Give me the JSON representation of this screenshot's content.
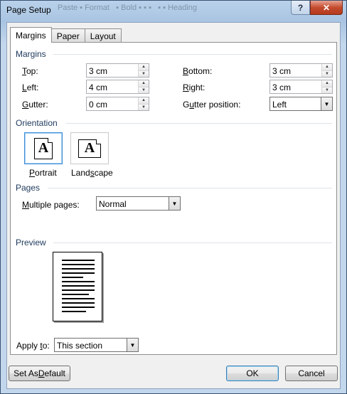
{
  "window": {
    "title": "Page Setup",
    "help_label": "?",
    "close_label": "✕"
  },
  "tabs": [
    {
      "label": "Margins",
      "active": true
    },
    {
      "label": "Paper",
      "active": false
    },
    {
      "label": "Layout",
      "active": false
    }
  ],
  "margins": {
    "section_label": "Margins",
    "top": {
      "label_u": "T",
      "label_rest": "op:",
      "value": "3 cm"
    },
    "left": {
      "label_u": "L",
      "label_rest": "eft:",
      "value": "4 cm"
    },
    "gutter": {
      "label_u": "G",
      "label_rest": "utter:",
      "value": "0 cm"
    },
    "bottom": {
      "label_u": "B",
      "label_rest": "ottom:",
      "value": "3 cm"
    },
    "right": {
      "label_u": "R",
      "label_rest": "ight:",
      "value": "3 cm"
    },
    "gutter_position": {
      "label_pre": "G",
      "label_u": "u",
      "label_rest": "tter position:",
      "value": "Left"
    }
  },
  "orientation": {
    "section_label": "Orientation",
    "icon_glyph": "A",
    "portrait": {
      "label_u": "P",
      "label_rest": "ortrait",
      "selected": true
    },
    "landscape": {
      "label_pre": "Land",
      "label_u": "s",
      "label_rest": "cape",
      "selected": false
    }
  },
  "pages": {
    "section_label": "Pages",
    "multiple_pages": {
      "label_u": "M",
      "label_rest": "ultiple pages:",
      "value": "Normal"
    }
  },
  "preview": {
    "section_label": "Preview"
  },
  "apply_to": {
    "label_pre": "Apply ",
    "label_u": "t",
    "label_rest": "o:",
    "value": "This section"
  },
  "buttons": {
    "set_default": {
      "label_pre": "Set As ",
      "label_u": "D",
      "label_rest": "efault"
    },
    "ok": "OK",
    "cancel": "Cancel"
  }
}
